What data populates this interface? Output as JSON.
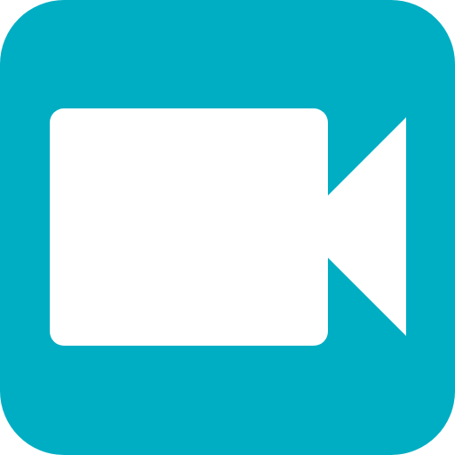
{
  "app_icon": {
    "icon": "video-camera-icon",
    "background_color": "#00AEC3",
    "glyph_color": "#FFFFFF"
  }
}
